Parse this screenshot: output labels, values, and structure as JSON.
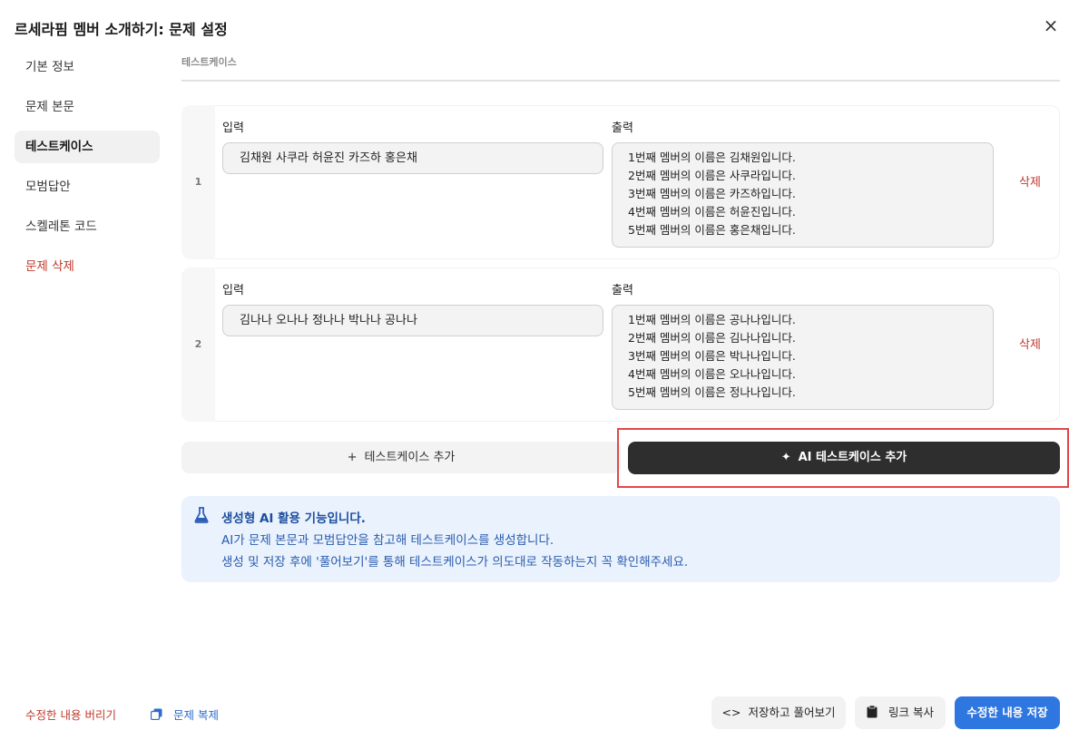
{
  "dialog": {
    "title": "르세라핌 멤버 소개하기: 문제 설정",
    "close_icon": "×"
  },
  "sidebar": {
    "items": [
      {
        "label": "기본 정보"
      },
      {
        "label": "문제 본문"
      },
      {
        "label": "테스트케이스",
        "active": true
      },
      {
        "label": "모범답안"
      },
      {
        "label": "스켈레톤 코드"
      },
      {
        "label": "문제 삭제",
        "danger": true
      }
    ]
  },
  "section": {
    "label": "테스트케이스"
  },
  "testcases": [
    {
      "number": "1",
      "input_label": "입력",
      "output_label": "출력",
      "input": "김채원 사쿠라 허윤진 카즈하 홍은채",
      "output": [
        "1번째 멤버의 이름은 김채원입니다.",
        "2번째 멤버의 이름은 사쿠라입니다.",
        "3번째 멤버의 이름은 카즈하입니다.",
        "4번째 멤버의 이름은 허윤진입니다.",
        "5번째 멤버의 이름은 홍은채입니다."
      ],
      "delete_label": "삭제"
    },
    {
      "number": "2",
      "input_label": "입력",
      "output_label": "출력",
      "input": "김나나 오나나 정나나 박나나 공나나",
      "output": [
        "1번째 멤버의 이름은 공나나입니다.",
        "2번째 멤버의 이름은 김나나입니다.",
        "3번째 멤버의 이름은 박나나입니다.",
        "4번째 멤버의 이름은 오나나입니다.",
        "5번째 멤버의 이름은 정나나입니다."
      ],
      "delete_label": "삭제"
    }
  ],
  "actions": {
    "add_icon": "+",
    "add_label": "테스트케이스 추가",
    "ai_icon": "✦",
    "ai_label": "AI 테스트케이스 추가"
  },
  "info": {
    "icon": "flask-icon",
    "title": "생성형 AI 활용 기능입니다.",
    "line1": "AI가 문제 본문과 모범답안을 참고해 테스트케이스를 생성합니다.",
    "line2": "생성 및 저장 후에 '풀어보기'를 통해 테스트케이스가 의도대로 작동하는지 꼭 확인해주세요."
  },
  "footer": {
    "discard_label": "수정한 내용 버리기",
    "duplicate_label": "문제 복제",
    "save_preview_label": "저장하고 풀어보기",
    "copy_link_label": "링크 복사",
    "save_label": "수정한 내용 저장"
  },
  "colors": {
    "danger": "#c0392b",
    "primary": "#2f77e0",
    "info_bg": "#eaf2fd",
    "highlight": "#e0484c"
  }
}
